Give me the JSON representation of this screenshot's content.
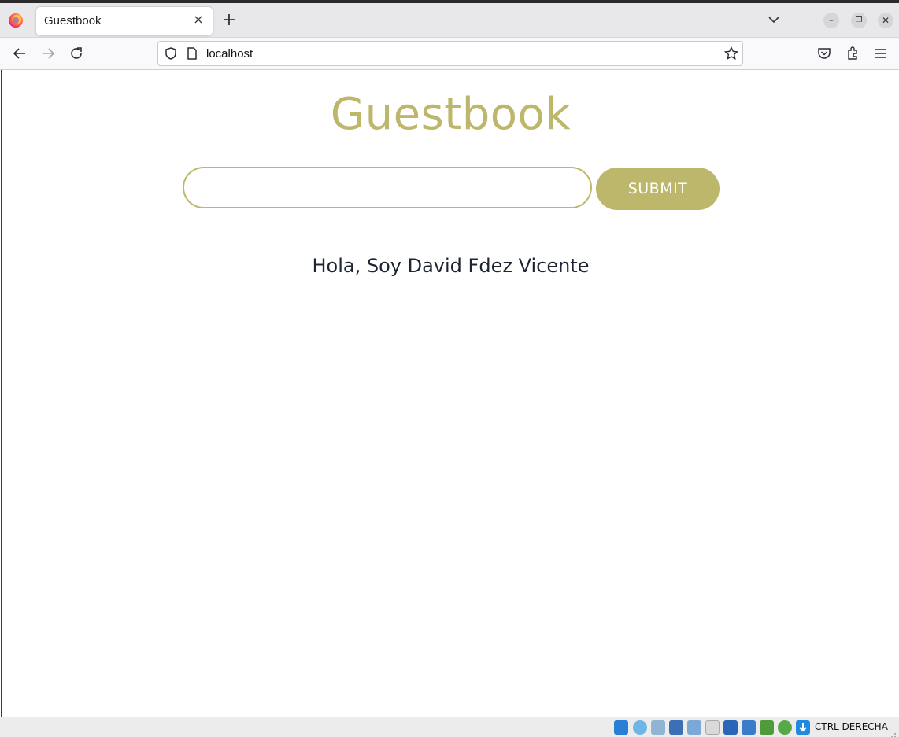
{
  "browser": {
    "tab": {
      "title": "Guestbook",
      "close_glyph": "×"
    },
    "new_tab_glyph": "+",
    "url": "localhost",
    "window_controls": {
      "minimize": "–",
      "restore": "❐",
      "close": "✕"
    }
  },
  "page": {
    "title": "Guestbook",
    "input": {
      "value": "",
      "placeholder": ""
    },
    "submit_label": "SUBMIT",
    "entries": [
      "Hola, Soy David Fdez Vicente"
    ],
    "accent_color": "#bdb76b"
  },
  "statusbar": {
    "host_key_label": "CTRL DERECHA",
    "icons": [
      "hard-disk-icon",
      "optical-drive-icon",
      "audio-icon",
      "network-icon",
      "usb-icon",
      "shared-folders-icon",
      "display-icon",
      "video-capture-icon",
      "mouse-integration-icon",
      "cpu-activity-icon",
      "globe-icon",
      "keyboard-capture-icon"
    ]
  }
}
